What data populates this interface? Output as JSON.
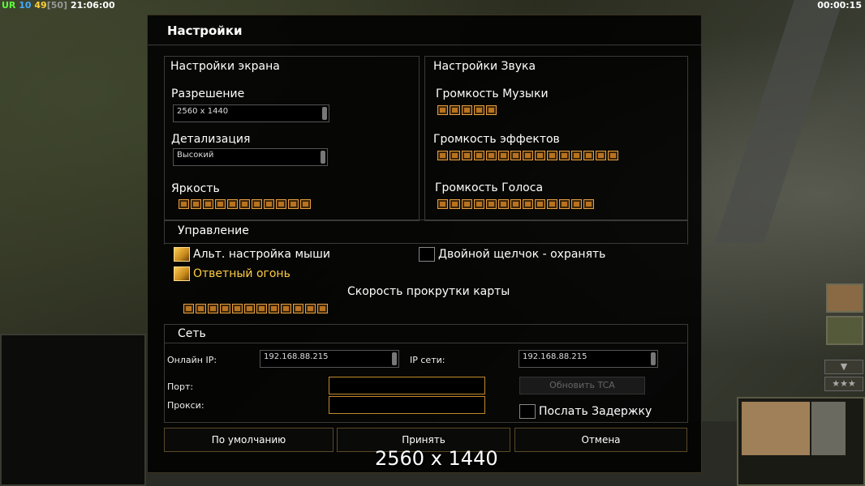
{
  "hud": {
    "left": {
      "tag": "UR",
      "num1": "10",
      "num2": "49",
      "num3": "[50]",
      "time": "21:06:00"
    },
    "right_time": "00:00:15"
  },
  "dialog": {
    "title": "Настройки",
    "screen": {
      "heading": "Настройки экрана",
      "resolution_label": "Разрешение",
      "resolution_value": "2560 x 1440",
      "detail_label": "Детализация",
      "detail_value": "Высокий",
      "brightness_label": "Яркость",
      "brightness_level": 11
    },
    "sound": {
      "heading": "Настройки Звука",
      "music_label": "Громкость Музыки",
      "music_level": 5,
      "effects_label": "Громкость эффектов",
      "effects_level": 15,
      "voice_label": "Громкость Голоса",
      "voice_level": 13
    },
    "control": {
      "heading": "Управление",
      "alt_mouse_label": "Альт. настройка мыши",
      "alt_mouse_checked": true,
      "return_fire_label": "Ответный огонь",
      "return_fire_checked": true,
      "double_click_label": "Двойной щелчок - охранять",
      "double_click_checked": false,
      "scroll_label": "Скорость прокрутки карты",
      "scroll_level": 12
    },
    "network": {
      "heading": "Сеть",
      "online_ip_label": "Онлайн IP:",
      "online_ip_value": "192.168.88.215",
      "lan_ip_label": "IP сети:",
      "lan_ip_value": "192.168.88.215",
      "port_label": "Порт:",
      "proxy_label": "Прокси:",
      "update_tca_label": "Обновить TCA",
      "send_delay_label": "Послать Задержку",
      "send_delay_checked": false
    },
    "buttons": {
      "defaults": "По умолчанию",
      "accept": "Принять",
      "cancel": "Отмена"
    }
  },
  "caption": "2560 x 1440",
  "colors": {
    "accent": "#c08a2a",
    "slider": "#b8721f"
  }
}
